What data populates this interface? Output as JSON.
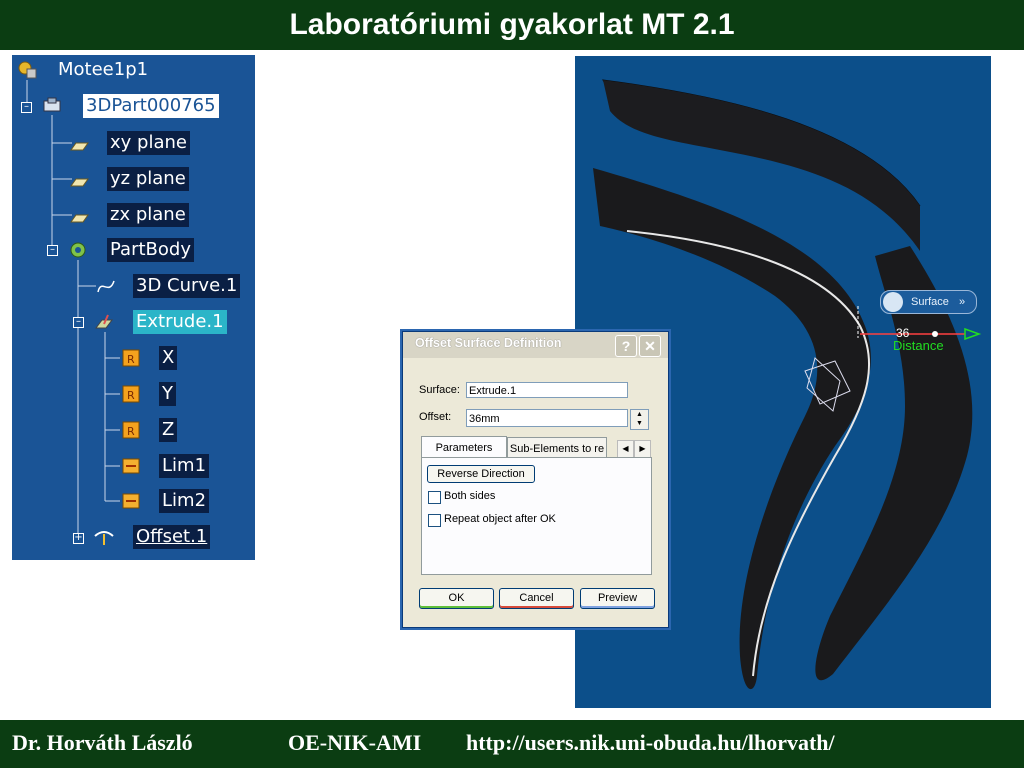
{
  "slide": {
    "title": "Laboratóriumi gyakorlat MT 2.1",
    "footer": {
      "author": "Dr. Horváth László",
      "org": "OE-NIK-AMI",
      "url": "http://users.nik.uni-obuda.hu/lhorvath/"
    }
  },
  "tree": {
    "root": "Motee1p1",
    "part": "3DPart000765",
    "planes": [
      "xy plane",
      "yz plane",
      "zx plane"
    ],
    "body": "PartBody",
    "curve": "3D Curve.1",
    "extrude": "Extrude.1",
    "params": [
      "X",
      "Y",
      "Z"
    ],
    "limits": [
      "Lim1",
      "Lim2"
    ],
    "offset": "Offset.1"
  },
  "viewport": {
    "surface_label": "Surface",
    "surface_chevron": "»",
    "distance_value": "36",
    "distance_label": "Distance"
  },
  "dialog": {
    "title": "Offset Surface Definition",
    "help": "?",
    "close": "✕",
    "surface_label": "Surface:",
    "surface_value": "Extrude.1",
    "offset_label": "Offset:",
    "offset_value": "36mm",
    "tabs": [
      "Parameters",
      "Sub-Elements to re"
    ],
    "reverse_direction": "Reverse Direction",
    "both_sides": "Both sides",
    "repeat_object": "Repeat object after OK",
    "ok": "OK",
    "cancel": "Cancel",
    "preview": "Preview"
  },
  "colors": {
    "header_bg": "#0b3d12",
    "tree_bg": "#1a5496",
    "viewport_bg": "#0c4f8a",
    "distance_green": "#22dd22"
  }
}
